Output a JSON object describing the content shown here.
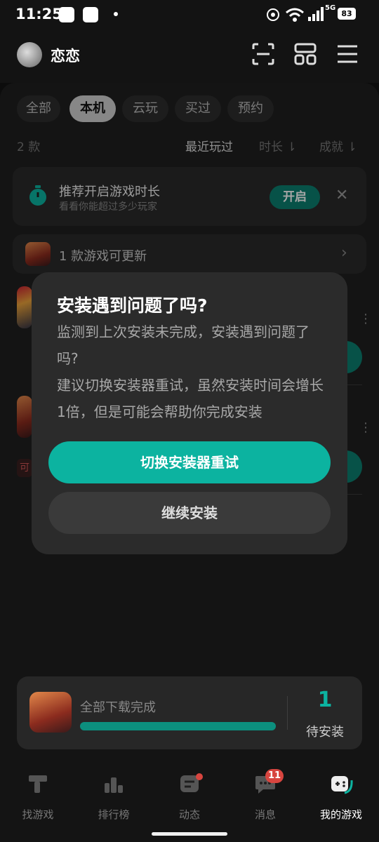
{
  "status_bar": {
    "time": "11:25",
    "network": "5G",
    "battery": "83"
  },
  "header": {
    "username": "恋恋",
    "icons": [
      "scan-icon",
      "layout-icon",
      "menu-icon"
    ]
  },
  "filters": {
    "chips": [
      "全部",
      "本机",
      "云玩",
      "买过",
      "预约"
    ],
    "active_index": 1
  },
  "list_info": {
    "count": "2 款",
    "sort_options": [
      "最近玩过",
      "时长",
      "成就"
    ],
    "active_sort": 0
  },
  "timer_banner": {
    "title": "推荐开启游戏时长",
    "subtitle": "看看你能超过多少玩家",
    "button": "开启"
  },
  "update_banner": {
    "text": "1 款游戏可更新"
  },
  "background_row": {
    "tag": "可"
  },
  "dialog": {
    "title": "安装遇到问题了吗?",
    "body": "监测到上次安装未完成，安装遇到问题了吗?\n建议切换安装器重试，虽然安装时间会增长1倍，但是可能会帮助你完成安装",
    "primary_button": "切换安装器重试",
    "secondary_button": "继续安装"
  },
  "download_card": {
    "text": "全部下载完成",
    "progress": 1.0,
    "count": "1",
    "label": "待安装"
  },
  "bottom_nav": {
    "items": [
      "找游戏",
      "排行榜",
      "动态",
      "消息",
      "我的游戏"
    ],
    "active_index": 4,
    "message_badge": "11"
  },
  "colors": {
    "accent": "#0cb3a0",
    "badge": "#d8453f"
  }
}
